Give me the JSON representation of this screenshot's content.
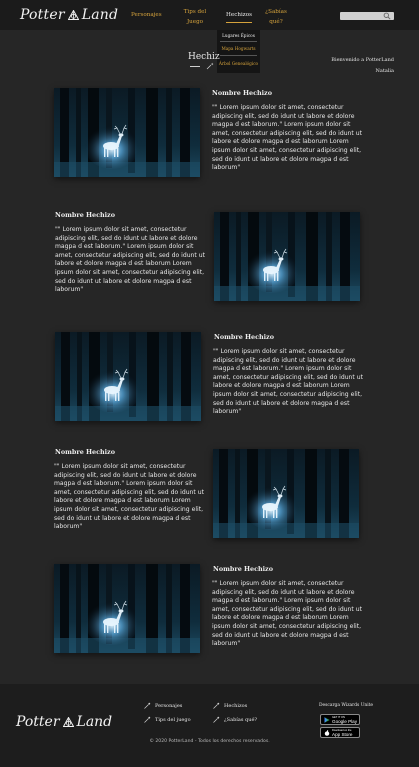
{
  "brand": {
    "name_left": "Potter",
    "name_right": "Land"
  },
  "nav": {
    "items": [
      {
        "label": "Personajes"
      },
      {
        "label": "Tips del Juego"
      },
      {
        "label": "Hechizos"
      },
      {
        "label": "¿Sabías qué?"
      }
    ],
    "active": "Hechizos"
  },
  "dropdown": {
    "items": [
      "Lugares Épicos",
      "Mapa Hogwarts",
      "Árbol Genealógico"
    ]
  },
  "search": {
    "placeholder": "",
    "icon": "search-icon"
  },
  "header": {
    "title": "Hechiz",
    "welcome": "Bienvenido a PotterLand",
    "user": "Natalia"
  },
  "cards": [
    {
      "title": "Nombre Hechizo",
      "text": "\"\" Lorem ipsum dolor sit amet, consectetur adipiscing elit, sed do idunt ut labore et dolore magpa d est laborum.\" Lorem ipsum dolor sit amet, consectetur adipiscing elit, sed do idunt ut labore et dolore magpa d est laborum Lorem ipsum dolor sit amet, consectetur adipiscing elit, sed do idunt ut labore et dolore magpa d est laborum\""
    },
    {
      "title": "Nombre Hechizo",
      "text": "\"\" Lorem ipsum dolor sit amet, consectetur adipiscing elit, sed do idunt ut labore et dolore magpa d est laborum.\" Lorem ipsum dolor sit amet, consectetur adipiscing elit, sed do idunt ut labore et dolore magpa d est laborum Lorem ipsum dolor sit amet, consectetur adipiscing elit, sed do idunt ut labore et dolore magpa d est laborum\""
    },
    {
      "title": "Nombre Hechizo",
      "text": "\"\" Lorem ipsum dolor sit amet, consectetur adipiscing elit, sed do idunt ut labore et dolore magpa d est laborum.\" Lorem ipsum dolor sit amet, consectetur adipiscing elit, sed do idunt ut labore et dolore magpa d est laborum Lorem ipsum dolor sit amet, consectetur adipiscing elit, sed do idunt ut labore et dolore magpa d est laborum\""
    },
    {
      "title": "Nombre Hechizo",
      "text": "\"\" Lorem ipsum dolor sit amet, consectetur adipiscing elit, sed do idunt ut labore et dolore magpa d est laborum.\" Lorem ipsum dolor sit amet, consectetur adipiscing elit, sed do idunt ut labore et dolore magpa d est laborum Lorem ipsum dolor sit amet, consectetur adipiscing elit, sed do idunt ut labore et dolore magpa d est laborum\""
    },
    {
      "title": "Nombre Hechizo",
      "text": "\"\" Lorem ipsum dolor sit amet, consectetur adipiscing elit, sed do idunt ut labore et dolore magpa d est laborum.\" Lorem ipsum dolor sit amet, consectetur adipiscing elit, sed do idunt ut labore et dolore magpa d est laborum Lorem ipsum dolor sit amet, consectetur adipiscing elit, sed do idunt ut labore et dolore magpa d est laborum\""
    }
  ],
  "footer": {
    "links": [
      "Personajes",
      "Hechizos",
      "Tips del juego",
      "¿Sabías qué?"
    ],
    "download_label": "Descarga Wizards Unite",
    "google_play": {
      "small": "GET IT ON",
      "big": "Google Play"
    },
    "app_store": {
      "small": "Download on the",
      "big": "App Store"
    },
    "copyright": "© 2020  PotterLand  -  Todos los derechos reservados."
  },
  "colors": {
    "gold": "#d6a33c",
    "background": "#262626",
    "topbar": "#1b1b1b"
  }
}
